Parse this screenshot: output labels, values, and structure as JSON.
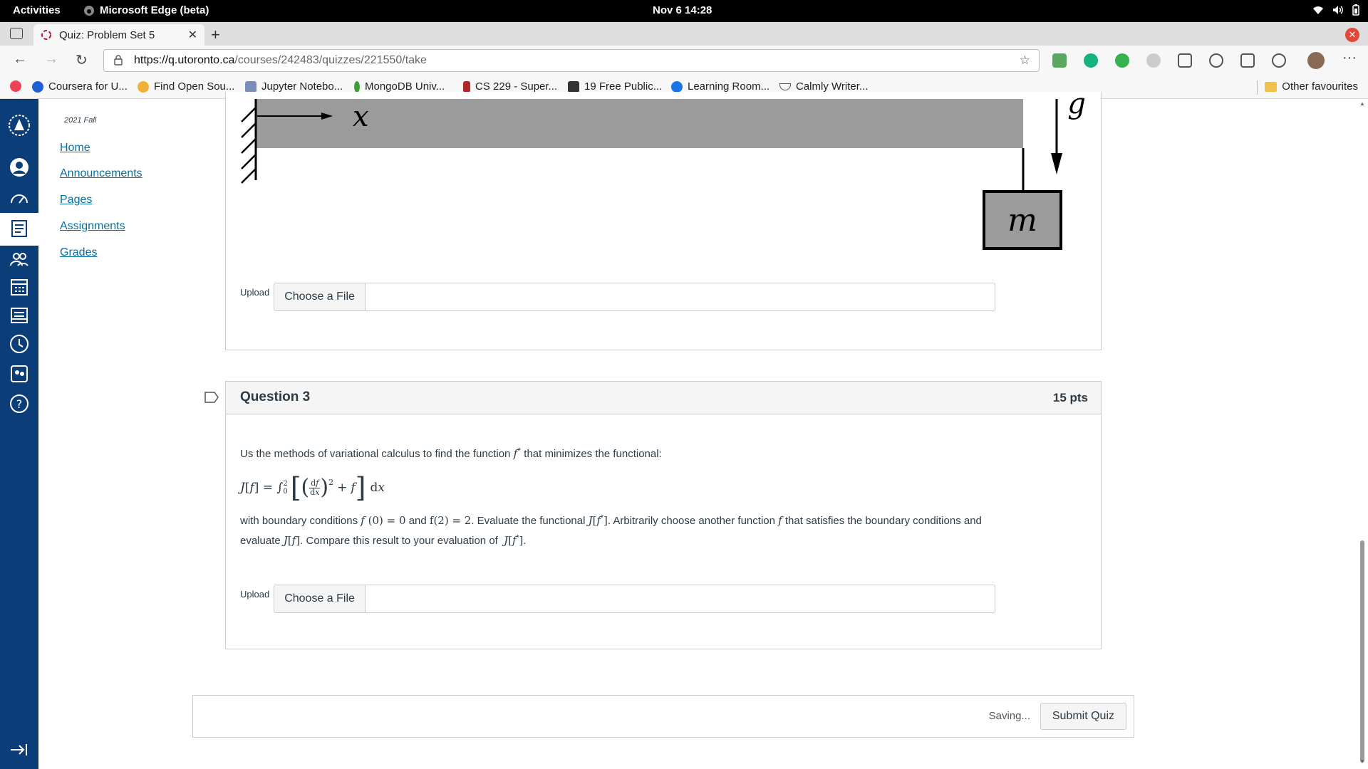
{
  "system_bar": {
    "activities": "Activities",
    "app_name": "Microsoft Edge (beta)",
    "clock": "Nov 6  14:28"
  },
  "browser": {
    "tab_title": "Quiz: Problem Set 5",
    "url_host": "https://q.utoronto.ca",
    "url_path": "/courses/242483/quizzes/221550/take",
    "bookmarks": [
      {
        "label": "Coursera for U...",
        "color": "#1f5fd6"
      },
      {
        "label": "Find Open Sou...",
        "color": "#f2b132"
      },
      {
        "label": "Jupyter Notebo...",
        "color": "#7a8fb5"
      },
      {
        "label": "MongoDB Univ...",
        "color": "#3fa037"
      },
      {
        "label": "CS 229 - Super...",
        "color": "#b1262a"
      },
      {
        "label": "19 Free Public...",
        "color": "#333333"
      },
      {
        "label": "Learning Room...",
        "color": "#1a73e8"
      },
      {
        "label": "Calmly Writer...",
        "color": "#555555"
      }
    ],
    "other_favourites": "Other favourites"
  },
  "course_nav": {
    "term": "2021 Fall",
    "links": [
      "Home",
      "Announcements",
      "Pages",
      "Assignments",
      "Grades"
    ]
  },
  "question2": {
    "figure": {
      "x_label": "x",
      "g_label": "g",
      "mass_label": "m"
    },
    "upload_label": "Upload",
    "choose_file": "Choose a File"
  },
  "question3": {
    "title": "Question 3",
    "points": "15 pts",
    "intro": "Us the methods of variational calculus to find the function",
    "intro_end": "that minimizes the functional:",
    "bc_prefix": "with boundary conditions",
    "bc_and": "and",
    "evaluate_text": ". Evaluate the functional",
    "arbitrary_text": ". Arbitrarily choose another function",
    "satisfies_text": "that satisfies the boundary conditions and",
    "evaluate2": "evaluate",
    "compare_text": ". Compare this result to your evaluation of",
    "upload_label": "Upload",
    "choose_file": "Choose a File"
  },
  "submit": {
    "saving": "Saving...",
    "button": "Submit Quiz"
  }
}
